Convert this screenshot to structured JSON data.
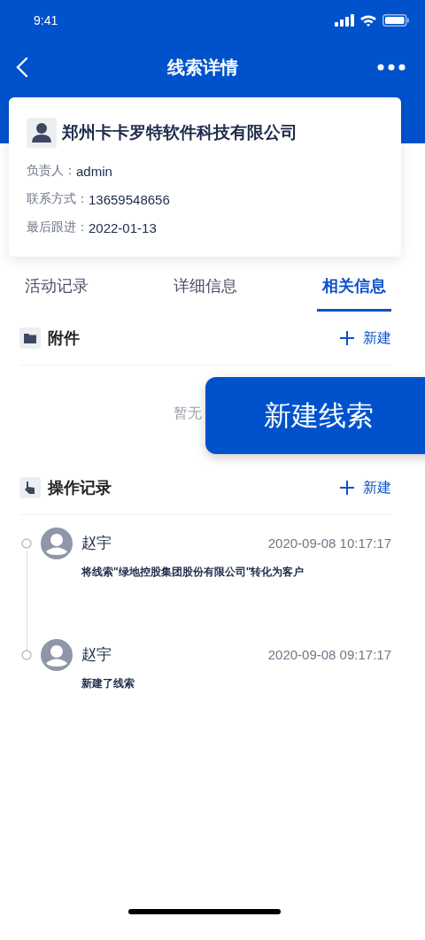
{
  "status_bar": {
    "time": "9:41"
  },
  "nav": {
    "title": "线索详情"
  },
  "card": {
    "company": "郑州卡卡罗特软件科技有限公司",
    "fields": [
      {
        "label": "负责人：",
        "value": "admin"
      },
      {
        "label": "联系方式：",
        "value": "13659548656"
      },
      {
        "label": "最后跟进：",
        "value": "2022-01-13"
      }
    ]
  },
  "tabs": [
    {
      "label": "活动记录",
      "selected": false
    },
    {
      "label": "详细信息",
      "selected": false
    },
    {
      "label": "相关信息",
      "selected": true
    }
  ],
  "sections": [
    {
      "kind": "attachments",
      "title": "附件",
      "action": "新建",
      "empty_text": "暂无"
    },
    {
      "kind": "operations",
      "title": "操作记录",
      "action": "新建",
      "records": [
        {
          "user": "赵宇",
          "time": "2020-09-08 10:17:17",
          "text": "将线索\"绿地控股集团股份有限公司\"转化为客户"
        },
        {
          "user": "赵宇",
          "time": "2020-09-08 09:17:17",
          "text": "新建了线索"
        }
      ]
    }
  ],
  "floating_button": {
    "label": "新建线索"
  }
}
